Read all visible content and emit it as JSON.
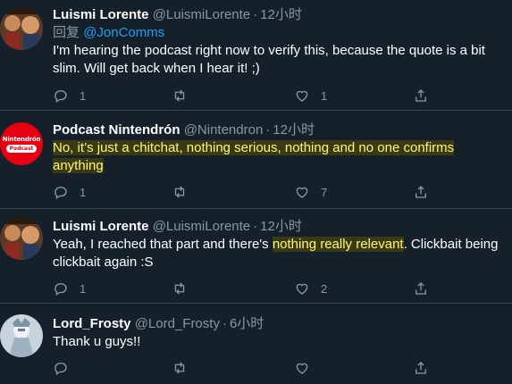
{
  "tweets": [
    {
      "display_name": "Luismi Lorente",
      "handle": "@LuismiLorente",
      "time": "12小时",
      "reply_label": "回复",
      "reply_mention": "@JonComms",
      "body": "I'm hearing the podcast right now to verify this, because the quote is a bit slim. Will get back when I hear it! ;)",
      "replies": "1",
      "retweets": "",
      "likes": "1"
    },
    {
      "display_name": "Podcast Nintendrón",
      "handle": "@Nintendron",
      "time": "12小时",
      "avatar_text_1": "Nintendrón",
      "avatar_text_2": "Podcast",
      "body_highlight": "No, it’s just a chitchat, nothing serious, nothing and no one confirms anything",
      "replies": "1",
      "retweets": "",
      "likes": "7"
    },
    {
      "display_name": "Luismi Lorente",
      "handle": "@LuismiLorente",
      "time": "12小时",
      "body_pre": "Yeah, I reached that part and there's ",
      "body_highlight": "nothing really relevant",
      "body_post": ". Clickbait being clickbait again :S",
      "replies": "1",
      "retweets": "",
      "likes": "2"
    },
    {
      "display_name": "Lord_Frosty",
      "handle": "@Lord_Frosty",
      "time": "6小时",
      "body": "Thank u guys!!",
      "replies": "",
      "retweets": "",
      "likes": ""
    }
  ],
  "icons": {
    "reply": "reply-icon",
    "retweet": "retweet-icon",
    "like": "heart-icon",
    "share": "share-icon"
  },
  "colors": {
    "background": "#15202b",
    "secondary_text": "#8899a6",
    "link": "#1da1f2",
    "highlight_text": "#fff67a",
    "divider": "#38444d"
  }
}
